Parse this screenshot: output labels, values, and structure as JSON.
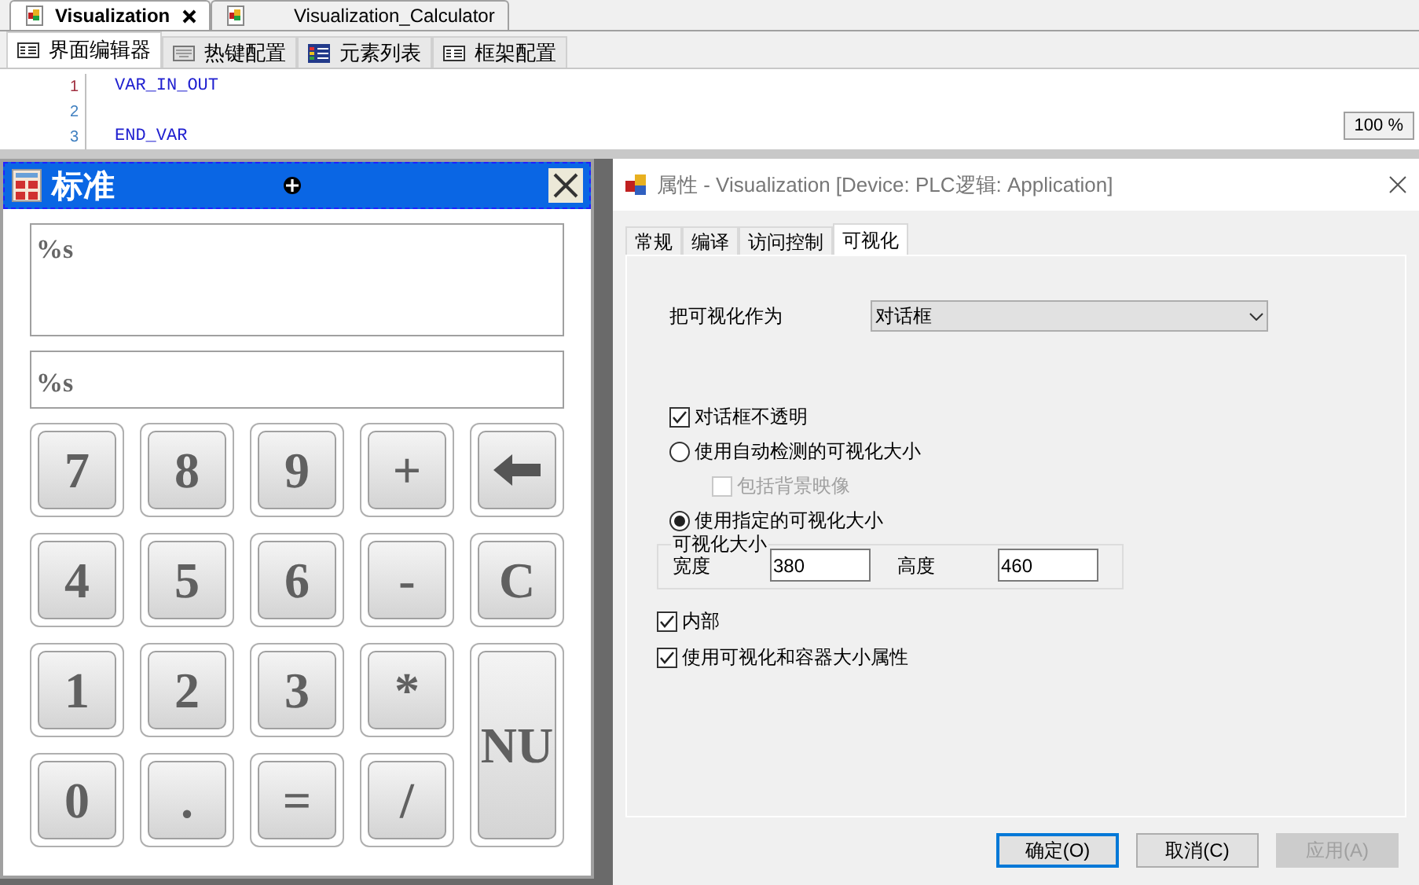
{
  "editor_tabs": [
    {
      "label": "Visualization",
      "selected": true,
      "closable": true
    },
    {
      "label": "Visualization_Calculator",
      "selected": false,
      "closable": false
    }
  ],
  "sub_tabs": [
    {
      "label": "界面编辑器",
      "selected": true
    },
    {
      "label": "热键配置",
      "selected": false
    },
    {
      "label": "元素列表",
      "selected": false
    },
    {
      "label": "框架配置",
      "selected": false
    }
  ],
  "code_lines": [
    {
      "number": "1",
      "text": "VAR_IN_OUT"
    },
    {
      "number": "2"
    },
    {
      "number": "3",
      "text": "END_VAR"
    }
  ],
  "zoom": "100 %",
  "calculator": {
    "title": "标准",
    "displays": [
      "%s",
      "%s"
    ],
    "keys": [
      {
        "kind": "text",
        "label": "7"
      },
      {
        "kind": "text",
        "label": "8"
      },
      {
        "kind": "text",
        "label": "9"
      },
      {
        "kind": "text",
        "label": "+"
      },
      {
        "kind": "backspace"
      },
      {
        "kind": "text",
        "label": "4"
      },
      {
        "kind": "text",
        "label": "5"
      },
      {
        "kind": "text",
        "label": "6"
      },
      {
        "kind": "text",
        "label": "-"
      },
      {
        "kind": "text",
        "label": "C"
      },
      {
        "kind": "text",
        "label": "1"
      },
      {
        "kind": "text",
        "label": "2"
      },
      {
        "kind": "text",
        "label": "3"
      },
      {
        "kind": "text",
        "label": "*"
      },
      {
        "kind": "tall",
        "label": "NU"
      },
      {
        "kind": "text",
        "label": "0"
      },
      {
        "kind": "text",
        "label": "."
      },
      {
        "kind": "text",
        "label": "="
      },
      {
        "kind": "text",
        "label": "/"
      }
    ]
  },
  "dialog": {
    "title": "属性 - Visualization [Device: PLC逻辑: Application]",
    "tabs": [
      {
        "label": "常规",
        "selected": false
      },
      {
        "label": "编译",
        "selected": false
      },
      {
        "label": "访问控制",
        "selected": false
      },
      {
        "label": "可视化",
        "selected": true
      }
    ],
    "use_as_label": "把可视化作为",
    "use_as_value": "对话框",
    "options": [
      {
        "kind": "checkbox",
        "label": "对话框不透明",
        "checked": true,
        "disabled": false,
        "indent": false
      },
      {
        "kind": "radio",
        "label": "使用自动检测的可视化大小",
        "checked": false,
        "disabled": false,
        "indent": false
      },
      {
        "kind": "checkbox",
        "label": "包括背景映像",
        "checked": false,
        "disabled": true,
        "indent": true
      },
      {
        "kind": "radio",
        "label": "使用指定的可视化大小",
        "checked": true,
        "disabled": false,
        "indent": false
      }
    ],
    "size_group": {
      "title": "可视化大小",
      "width_label": "宽度",
      "width_value": "380",
      "height_label": "高度",
      "height_value": "460"
    },
    "bottom_options": [
      {
        "label": "内部",
        "checked": true
      },
      {
        "label": "使用可视化和容器大小属性",
        "checked": true
      }
    ],
    "buttons": [
      {
        "label": "确定(O)",
        "default": true,
        "disabled": false
      },
      {
        "label": "取消(C)",
        "default": false,
        "disabled": false
      },
      {
        "label": "应用(A)",
        "default": false,
        "disabled": true
      }
    ]
  }
}
